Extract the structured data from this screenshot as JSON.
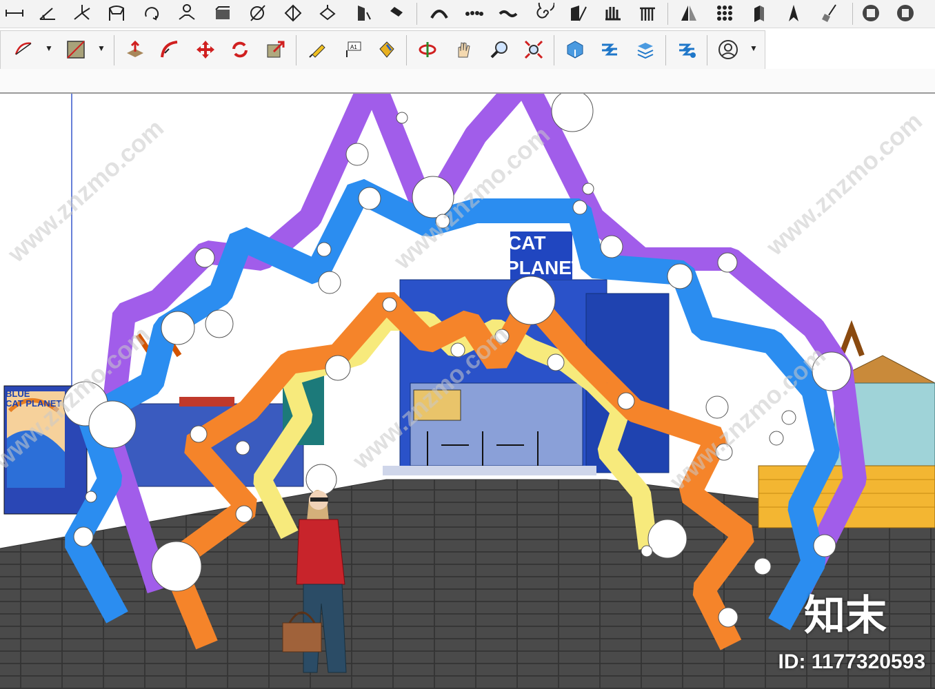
{
  "toolbar_top": {
    "tools": [
      "dimension-tool",
      "protractor-tool",
      "axes-tool",
      "sandbox-from-contours-tool",
      "sandbox-smoove-tool",
      "sandbox-stamp-tool",
      "sandbox-drape-tool",
      "sandbox-add-detail-tool",
      "sandbox-flip-edge-tool",
      "sandbox-from-scratch-tool",
      "position-camera-tool",
      "follow-me-tool",
      "3d-text-tool",
      "spiral-tool",
      "section-plane-tool",
      "column-tool",
      "railing-tool",
      "mirror-tool",
      "array-tool",
      "extrude-tool",
      "north-arrow-tool",
      "paint-broom-tool",
      "model-info-button",
      "sync-button"
    ]
  },
  "toolbar_second": {
    "tools": [
      "arc-tool",
      "rectangle-tool",
      "push-pull-tool",
      "follow-me-tool",
      "move-tool",
      "rotate-tool",
      "scale-tool",
      "tape-measure-tool",
      "text-tool",
      "paint-bucket-tool",
      "orbit-tool",
      "pan-tool",
      "zoom-tool",
      "zoom-extents-tool",
      "3d-warehouse-tool",
      "extension-warehouse-tool",
      "layout-send-tool",
      "extension-manager-tool",
      "account-button"
    ]
  },
  "scene": {
    "truck_sign": "BLUE\nCAT PLANET",
    "building_sign_line1": "CAT",
    "building_sign_line2": "PLANET"
  },
  "watermark": {
    "site": "www.znzmo.com",
    "brand": "知末",
    "id_text": "ID: 1177320593"
  }
}
